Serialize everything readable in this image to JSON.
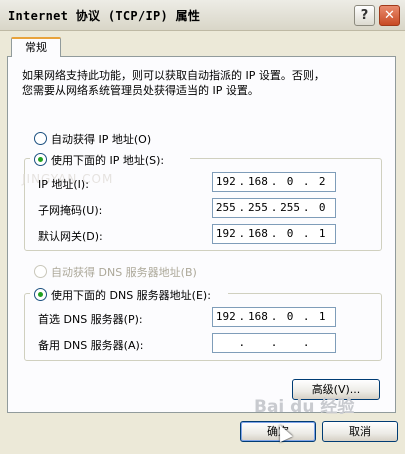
{
  "window": {
    "title": "Internet 协议 (TCP/IP) 属性",
    "help_label": "?",
    "close_label": "✕"
  },
  "tabs": [
    {
      "label": "常规"
    }
  ],
  "intro_line1": "如果网络支持此功能，则可以获取自动指派的 IP 设置。否则，",
  "intro_line2": "您需要从网络系统管理员处获得适当的 IP 设置。",
  "ip_auto": {
    "label": "自动获得 IP 地址(O)",
    "selected": false
  },
  "ip_manual": {
    "label": "使用下面的 IP 地址(S):",
    "selected": true
  },
  "watermark": "JINGYAN.COM",
  "fields": {
    "ip": {
      "label": "IP 地址(I):",
      "value": [
        "192",
        "168",
        "0",
        "2"
      ]
    },
    "mask": {
      "label": "子网掩码(U):",
      "value": [
        "255",
        "255",
        "255",
        "0"
      ]
    },
    "gateway": {
      "label": "默认网关(D):",
      "value": [
        "192",
        "168",
        "0",
        "1"
      ]
    },
    "dns_primary": {
      "label": "首选 DNS 服务器(P):",
      "value": [
        "192",
        "168",
        "0",
        "1"
      ]
    },
    "dns_alternate": {
      "label": "备用 DNS 服务器(A):",
      "value": [
        "",
        "",
        "",
        ""
      ]
    }
  },
  "dns_auto": {
    "label": "自动获得 DNS 服务器地址(B)",
    "selected": false,
    "disabled": true
  },
  "dns_manual": {
    "label": "使用下面的 DNS 服务器地址(E):",
    "selected": true
  },
  "buttons": {
    "advanced": "高级(V)...",
    "ok": "确定",
    "cancel": "取消"
  },
  "baidu_watermark": "Bai du 经验"
}
